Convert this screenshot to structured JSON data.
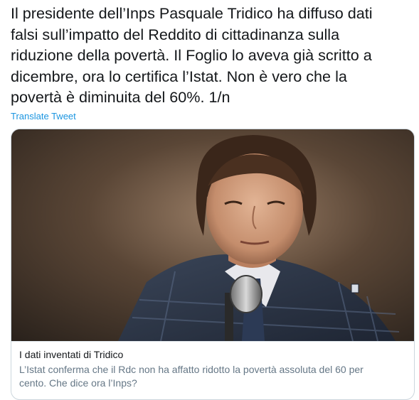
{
  "tweet": {
    "text_lines": [
      "Il presidente dell’Inps Pasquale Tridico ha diffuso dati",
      "falsi sull’impatto del Reddito di cittadinanza sulla",
      "riduzione della povertà. Il Foglio lo aveva già scritto a",
      "dicembre, ora lo certifica l’Istat. Non è vero che la",
      "povertà è diminuita del 60%. 1/n"
    ],
    "translate_label": "Translate Tweet"
  },
  "card": {
    "image_description_icon": "press-photo",
    "title": "I dati inventati di Tridico",
    "description_lines": [
      "L’Istat conferma che il Rdc non ha affatto ridotto la povertà assoluta del 60 per",
      "cento. Che dice ora l’Inps?"
    ]
  },
  "colors": {
    "text": "#14171a",
    "link": "#1b95e0",
    "muted": "#657786",
    "border": "#ccd6dd"
  }
}
